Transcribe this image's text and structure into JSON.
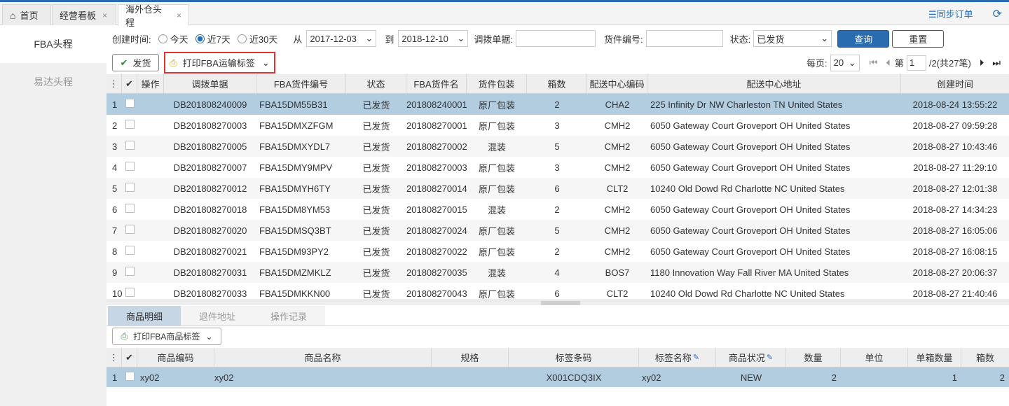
{
  "tabs": [
    {
      "label": "首页",
      "icon": "home-icon"
    },
    {
      "label": "经营看板",
      "close": "×"
    },
    {
      "label": "海外仓头程",
      "close": "×",
      "active": true
    }
  ],
  "header_right": {
    "sync_label": "☰同步订单",
    "refresh_icon": "refresh-icon"
  },
  "sidebar": {
    "items": [
      {
        "label": "FBA头程",
        "active": true
      },
      {
        "label": "易达头程"
      }
    ]
  },
  "filter": {
    "created_label": "创建时间:",
    "radios": [
      {
        "label": "今天",
        "checked": false
      },
      {
        "label": "近7天",
        "checked": true
      },
      {
        "label": "近30天",
        "checked": false
      }
    ],
    "from_label": "从",
    "from_date": "2017-12-03",
    "to_label": "到",
    "to_date": "2018-12-10",
    "transfer_label": "调拨单据:",
    "transfer_value": "",
    "cargo_label": "货件编号:",
    "cargo_value": "",
    "status_label": "状态:",
    "status_value": "已发货",
    "query_label": "查询",
    "reset_label": "重置"
  },
  "actions": {
    "ship_label": "发货",
    "print_fba_label": "打印FBA运输标签"
  },
  "pager": {
    "per_page_label": "每页:",
    "per_page": "20",
    "page_prefix": "第",
    "page": "1",
    "page_suffix": "/2(共27笔)"
  },
  "grid": {
    "columns": [
      "操作",
      "调拨单据",
      "FBA货件编号",
      "状态",
      "FBA货件名",
      "货件包装",
      "箱数",
      "配送中心编码",
      "配送中心地址",
      "创建时间"
    ],
    "rows": [
      {
        "n": "1",
        "doc": "DB201808240009",
        "fba": "FBA15DM55B31",
        "status": "已发货",
        "name": "201808240001",
        "pack": "原厂包装",
        "boxes": "2",
        "center": "CHA2",
        "addr": "225 Infinity Dr NW Charleston TN United States",
        "time": "2018-08-24 13:55:22"
      },
      {
        "n": "2",
        "doc": "DB201808270003",
        "fba": "FBA15DMXZFGM",
        "status": "已发货",
        "name": "201808270001",
        "pack": "原厂包装",
        "boxes": "3",
        "center": "CMH2",
        "addr": "6050 Gateway Court Groveport OH United States",
        "time": "2018-08-27 09:59:28"
      },
      {
        "n": "3",
        "doc": "DB201808270005",
        "fba": "FBA15DMXYDL7",
        "status": "已发货",
        "name": "201808270002",
        "pack": "混装",
        "boxes": "5",
        "center": "CMH2",
        "addr": "6050 Gateway Court Groveport OH United States",
        "time": "2018-08-27 10:43:46"
      },
      {
        "n": "4",
        "doc": "DB201808270007",
        "fba": "FBA15DMY9MPV",
        "status": "已发货",
        "name": "201808270003",
        "pack": "原厂包装",
        "boxes": "3",
        "center": "CMH2",
        "addr": "6050 Gateway Court Groveport OH United States",
        "time": "2018-08-27 11:29:10"
      },
      {
        "n": "5",
        "doc": "DB201808270012",
        "fba": "FBA15DMYH6TY",
        "status": "已发货",
        "name": "201808270014",
        "pack": "原厂包装",
        "boxes": "6",
        "center": "CLT2",
        "addr": "10240 Old Dowd Rd Charlotte NC United States",
        "time": "2018-08-27 12:01:38"
      },
      {
        "n": "6",
        "doc": "DB201808270018",
        "fba": "FBA15DM8YM53",
        "status": "已发货",
        "name": "201808270015",
        "pack": "混装",
        "boxes": "2",
        "center": "CMH2",
        "addr": "6050 Gateway Court Groveport OH United States",
        "time": "2018-08-27 14:34:23"
      },
      {
        "n": "7",
        "doc": "DB201808270020",
        "fba": "FBA15DMSQ3BT",
        "status": "已发货",
        "name": "201808270024",
        "pack": "原厂包装",
        "boxes": "5",
        "center": "CMH2",
        "addr": "6050 Gateway Court Groveport OH United States",
        "time": "2018-08-27 16:05:06"
      },
      {
        "n": "8",
        "doc": "DB201808270021",
        "fba": "FBA15DM93PY2",
        "status": "已发货",
        "name": "201808270022",
        "pack": "原厂包装",
        "boxes": "2",
        "center": "CMH2",
        "addr": "6050 Gateway Court Groveport OH United States",
        "time": "2018-08-27 16:08:15"
      },
      {
        "n": "9",
        "doc": "DB201808270031",
        "fba": "FBA15DMZMKLZ",
        "status": "已发货",
        "name": "201808270035",
        "pack": "混装",
        "boxes": "4",
        "center": "BOS7",
        "addr": "1180 Innovation Way Fall River MA United States",
        "time": "2018-08-27 20:06:37"
      },
      {
        "n": "10",
        "doc": "DB201808270033",
        "fba": "FBA15DMKKN00",
        "status": "已发货",
        "name": "201808270043",
        "pack": "原厂包装",
        "boxes": "6",
        "center": "CLT2",
        "addr": "10240 Old Dowd Rd Charlotte NC United States",
        "time": "2018-08-27 21:40:46"
      }
    ]
  },
  "subtabs": [
    {
      "label": "商品明细",
      "active": true
    },
    {
      "label": "退件地址"
    },
    {
      "label": "操作记录"
    }
  ],
  "sub_actions": {
    "print_label": "打印FBA商品标签"
  },
  "sub_grid": {
    "columns": [
      "商品编码",
      "商品名称",
      "规格",
      "标签条码",
      "标签名称",
      "商品状况",
      "数量",
      "单位",
      "单箱数量",
      "箱数"
    ],
    "rows": [
      {
        "n": "1",
        "code": "xy02",
        "name": "xy02",
        "spec": "",
        "barcode": "X001CDQ3IX",
        "label": "xy02",
        "cond": "NEW",
        "qty": "2",
        "unit": "",
        "perbox": "1",
        "boxes": "2"
      }
    ]
  }
}
